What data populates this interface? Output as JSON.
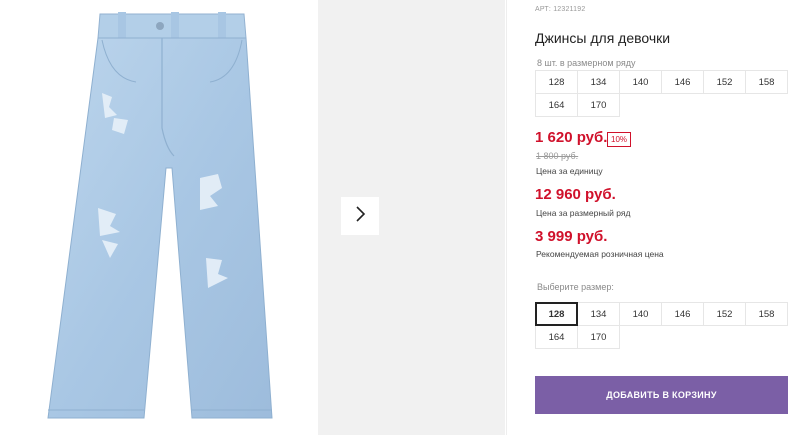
{
  "product": {
    "article": "АРТ: 12321192",
    "title": "Джинсы для девочки",
    "pack_note": "8 шт. в размерном ряду",
    "pack_sizes": [
      "128",
      "134",
      "140",
      "146",
      "152",
      "158",
      "164",
      "170"
    ],
    "price": "1 620 руб.",
    "discount": "10%",
    "old_price": "1 800 руб.",
    "price_label": "Цена за единицу",
    "pack_price": "12 960 руб.",
    "pack_price_label": "Цена за размерный ряд",
    "retail_price": "3 999 руб.",
    "retail_price_label": "Рекомендуемая розничная цена",
    "choose_size_label": "Выберите размер:",
    "size_options": [
      "128",
      "134",
      "140",
      "146",
      "152",
      "158",
      "164",
      "170"
    ],
    "selected_size": "128",
    "add_to_cart": "ДОБАВИТЬ В КОРЗИНУ"
  },
  "colors": {
    "accent_price": "#d0112b",
    "cart_button": "#7b5fa6",
    "denim": "#aecbe6"
  },
  "gallery": {
    "image_icon": "jeans-image",
    "next_icon": "chevron-right-icon"
  }
}
